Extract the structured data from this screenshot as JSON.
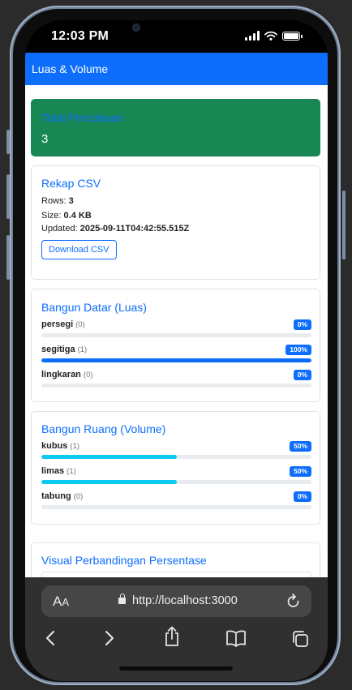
{
  "status": {
    "time": "12:03 PM"
  },
  "navbar": {
    "brand": "Luas & Volume"
  },
  "total": {
    "title": "Total Percobaan",
    "value": "3"
  },
  "csv": {
    "title": "Rekap CSV",
    "rows_label": "Rows:",
    "rows_value": "3",
    "size_label": "Size:",
    "size_value": "0.4 KB",
    "updated_label": "Updated:",
    "updated_value": "2025-09-11T04:42:55.515Z",
    "download_label": "Download CSV"
  },
  "luas": {
    "title": "Bangun Datar (Luas)",
    "items": [
      {
        "name": "persegi",
        "count": "(0)",
        "percent_label": "0%",
        "percent": 0
      },
      {
        "name": "segitiga",
        "count": "(1)",
        "percent_label": "100%",
        "percent": 100
      },
      {
        "name": "lingkaran",
        "count": "(0)",
        "percent_label": "0%",
        "percent": 0
      }
    ],
    "bar_color": "#0d6efd"
  },
  "volume": {
    "title": "Bangun Ruang (Volume)",
    "items": [
      {
        "name": "kubus",
        "count": "(1)",
        "percent_label": "50%",
        "percent": 50
      },
      {
        "name": "limas",
        "count": "(1)",
        "percent_label": "50%",
        "percent": 50
      },
      {
        "name": "tabung",
        "count": "(0)",
        "percent_label": "0%",
        "percent": 0
      }
    ],
    "bar_color": "#0dcaf0"
  },
  "visual": {
    "title": "Visual Perbandingan Persentase"
  },
  "browser": {
    "aa_big": "A",
    "aa_small": "A",
    "url": "http://localhost:3000",
    "icons": [
      "aa-icon",
      "lock-icon",
      "reload-icon",
      "back-icon",
      "forward-icon",
      "share-icon",
      "bookmarks-icon",
      "tabs-icon"
    ]
  },
  "colors": {
    "primary": "#0d6efd",
    "success": "#198754",
    "info": "#0dcaf0"
  }
}
